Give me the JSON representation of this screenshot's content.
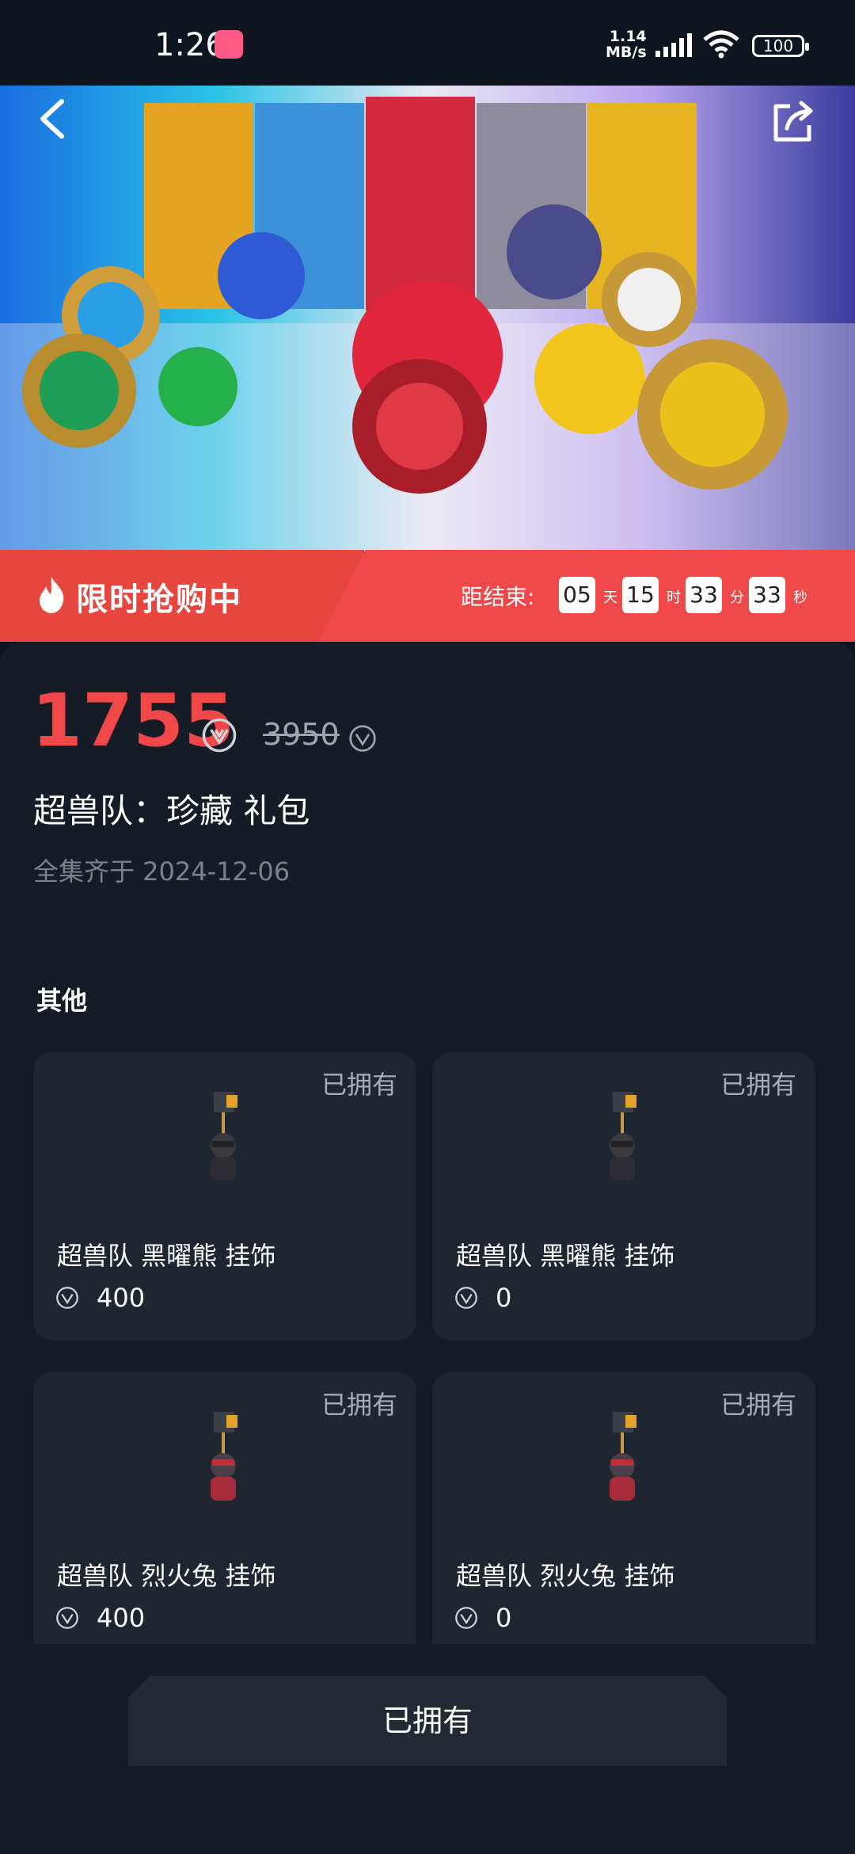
{
  "status_bar": {
    "time": "1:26",
    "net_speed_top": "1.14",
    "net_speed_bottom": "MB/s",
    "battery": "100"
  },
  "flash_sale": {
    "title": "限时抢购中",
    "ends_label": "距结束:",
    "days": "05",
    "days_unit": "天",
    "hours": "15",
    "hours_unit": "时",
    "minutes": "33",
    "minutes_unit": "分",
    "seconds": "33",
    "seconds_unit": "秒"
  },
  "product": {
    "price": "1755",
    "original_price": "3950",
    "title": "超兽队：珍藏 礼包",
    "completed_date": "全集齐于 2024-12-06"
  },
  "section_title": "其他",
  "items": [
    {
      "owned": "已拥有",
      "name": "超兽队 黑曜熊 挂饰",
      "price": "400"
    },
    {
      "owned": "已拥有",
      "name": "超兽队 黑曜熊 挂饰",
      "price": "0"
    },
    {
      "owned": "已拥有",
      "name": "超兽队 烈火兔 挂饰",
      "price": "400"
    },
    {
      "owned": "已拥有",
      "name": "超兽队 烈火兔 挂饰",
      "price": "0"
    }
  ],
  "bottom_button": "已拥有",
  "colors": {
    "accent": "#f04848",
    "background": "#161c25",
    "card": "#1f2630"
  }
}
